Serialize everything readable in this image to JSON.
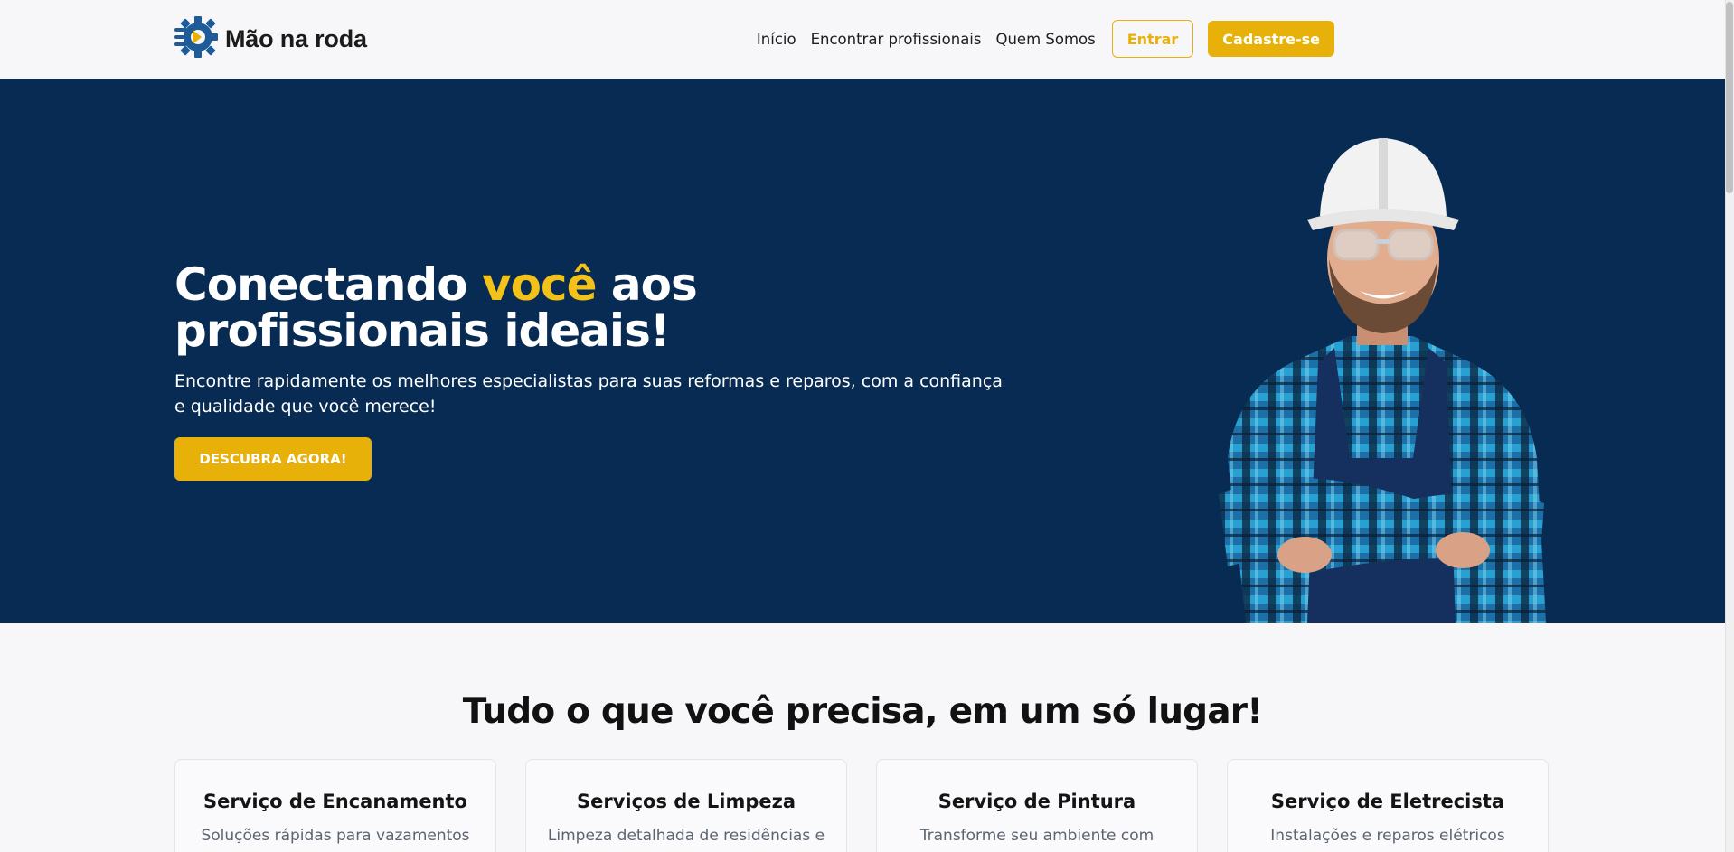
{
  "header": {
    "brand_name": "Mão na roda",
    "nav": [
      "Início",
      "Encontrar profissionais",
      "Quem Somos"
    ],
    "login_label": "Entrar",
    "signup_label": "Cadastre-se"
  },
  "hero": {
    "title_part1": "Conectando ",
    "title_accent": "você",
    "title_part2": " aos profissionais ideais!",
    "subtitle": "Encontre rapidamente os melhores especialistas para suas reformas e reparos, com a confiança e qualidade que você merece!",
    "cta_label": "DESCUBRA AGORA!"
  },
  "services": {
    "title": "Tudo o que você precisa, em um só lugar!",
    "cards": [
      {
        "title": "Serviço de Encanamento",
        "desc": "Soluções rápidas para vazamentos"
      },
      {
        "title": "Serviços de Limpeza",
        "desc": "Limpeza detalhada de residências e"
      },
      {
        "title": "Serviço de Pintura",
        "desc": "Transforme seu ambiente com"
      },
      {
        "title": "Serviço de Eletrecista",
        "desc": "Instalações e reparos elétricos"
      }
    ]
  },
  "colors": {
    "accent": "#e8b10a",
    "hero_bg": "#072b52",
    "brand_blue": "#1d5c99"
  },
  "icons": {
    "logo": "gear-hand-logo-icon"
  }
}
